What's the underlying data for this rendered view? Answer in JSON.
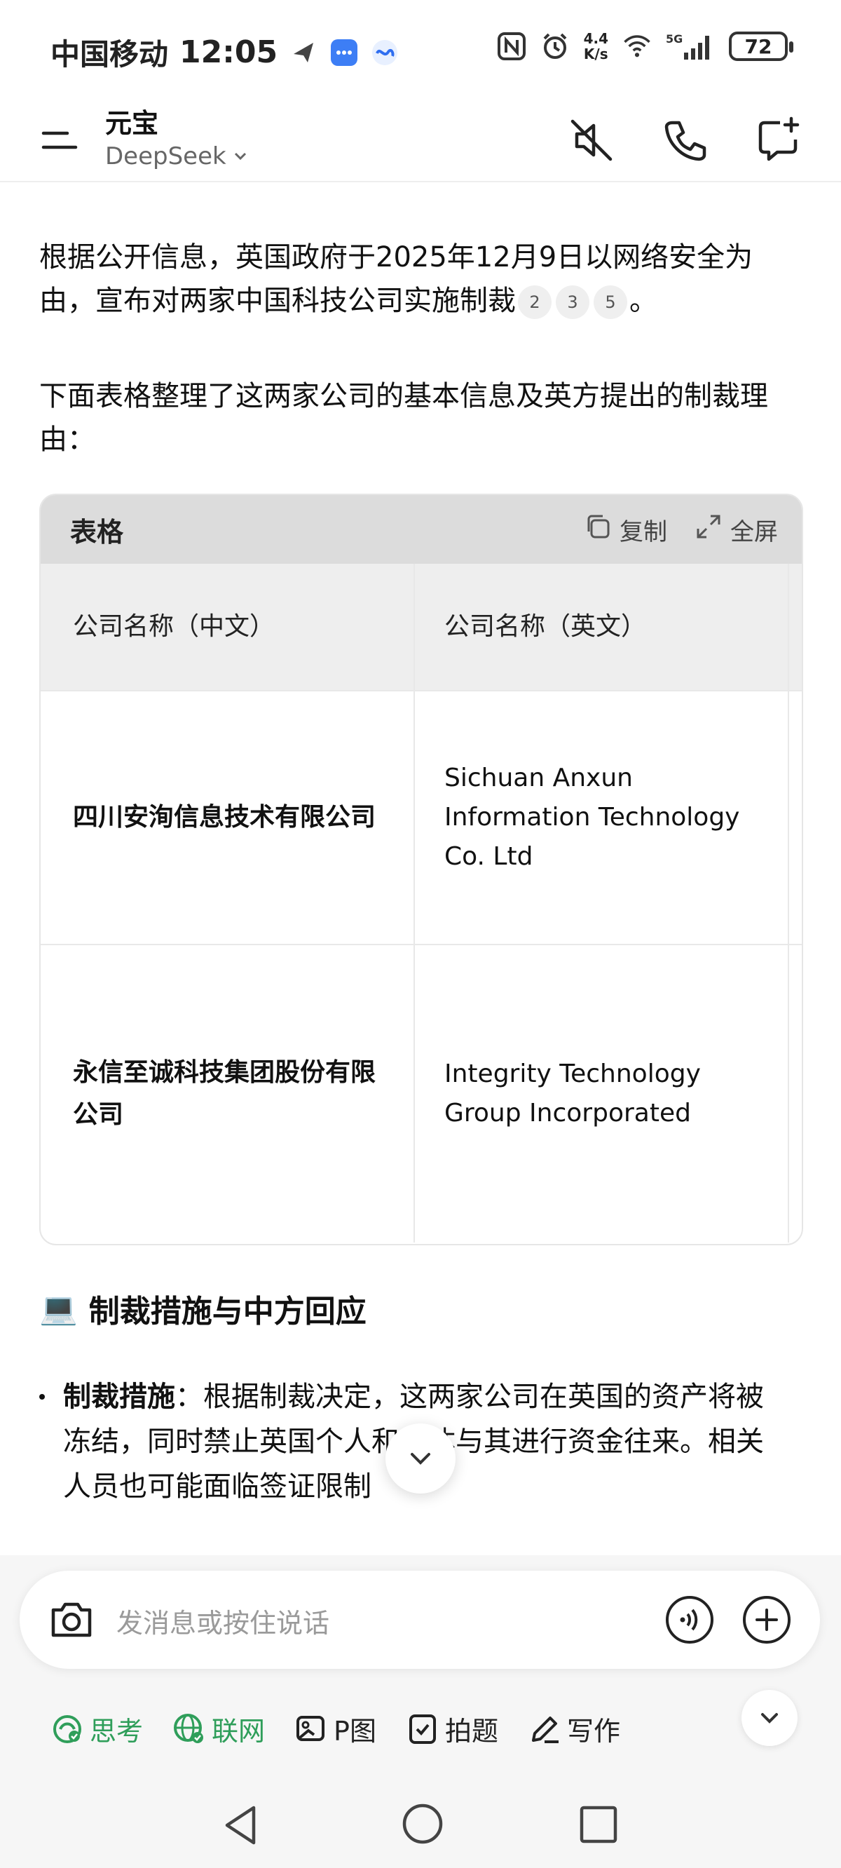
{
  "status_bar": {
    "carrier": "中国移动",
    "time": "12:05",
    "net_speed_value": "4.4",
    "net_speed_unit": "K/s",
    "network": "5G",
    "battery": "72"
  },
  "header": {
    "title": "元宝",
    "model": "DeepSeek"
  },
  "message": {
    "para1": "根据公开信息，英国政府于2025年12月9日以网络安全为由，宣布对两家中国科技公司实施制裁",
    "para1_citations": [
      "2",
      "3",
      "5"
    ],
    "para1_end": "。",
    "para2": "下面表格整理了这两家公司的基本信息及英方提出的制裁理由："
  },
  "table": {
    "label": "表格",
    "copy_label": "复制",
    "fullscreen_label": "全屏",
    "headers": [
      "公司名称（中文）",
      "公司名称（英文）"
    ],
    "rows": [
      [
        "四川安洵信息技术有限公司",
        "Sichuan Anxun Information Technology Co. Ltd"
      ],
      [
        "永信至诚科技集团股份有限公司",
        "Integrity Technology Group Incorporated"
      ]
    ]
  },
  "section": {
    "emoji": "💻",
    "title": "制裁措施与中方回应",
    "bullet1_label": "制裁措施",
    "bullet1_text": "：根据制裁决定，这两家公司在英国的资产将被冻结，同时禁止英国个人和实体与其进行资金往来。相关人员也可能面临签证限制"
  },
  "input": {
    "placeholder": "发消息或按住说话"
  },
  "tools": [
    {
      "label": "思考",
      "color": "#2f9e5a"
    },
    {
      "label": "联网",
      "color": "#2f9e5a"
    },
    {
      "label": "P图",
      "color": "#222222"
    },
    {
      "label": "拍题",
      "color": "#222222"
    },
    {
      "label": "写作",
      "color": "#222222"
    }
  ],
  "colors": {
    "accent_green": "#2f9e5a",
    "table_header_bg": "#dcdcdc"
  }
}
